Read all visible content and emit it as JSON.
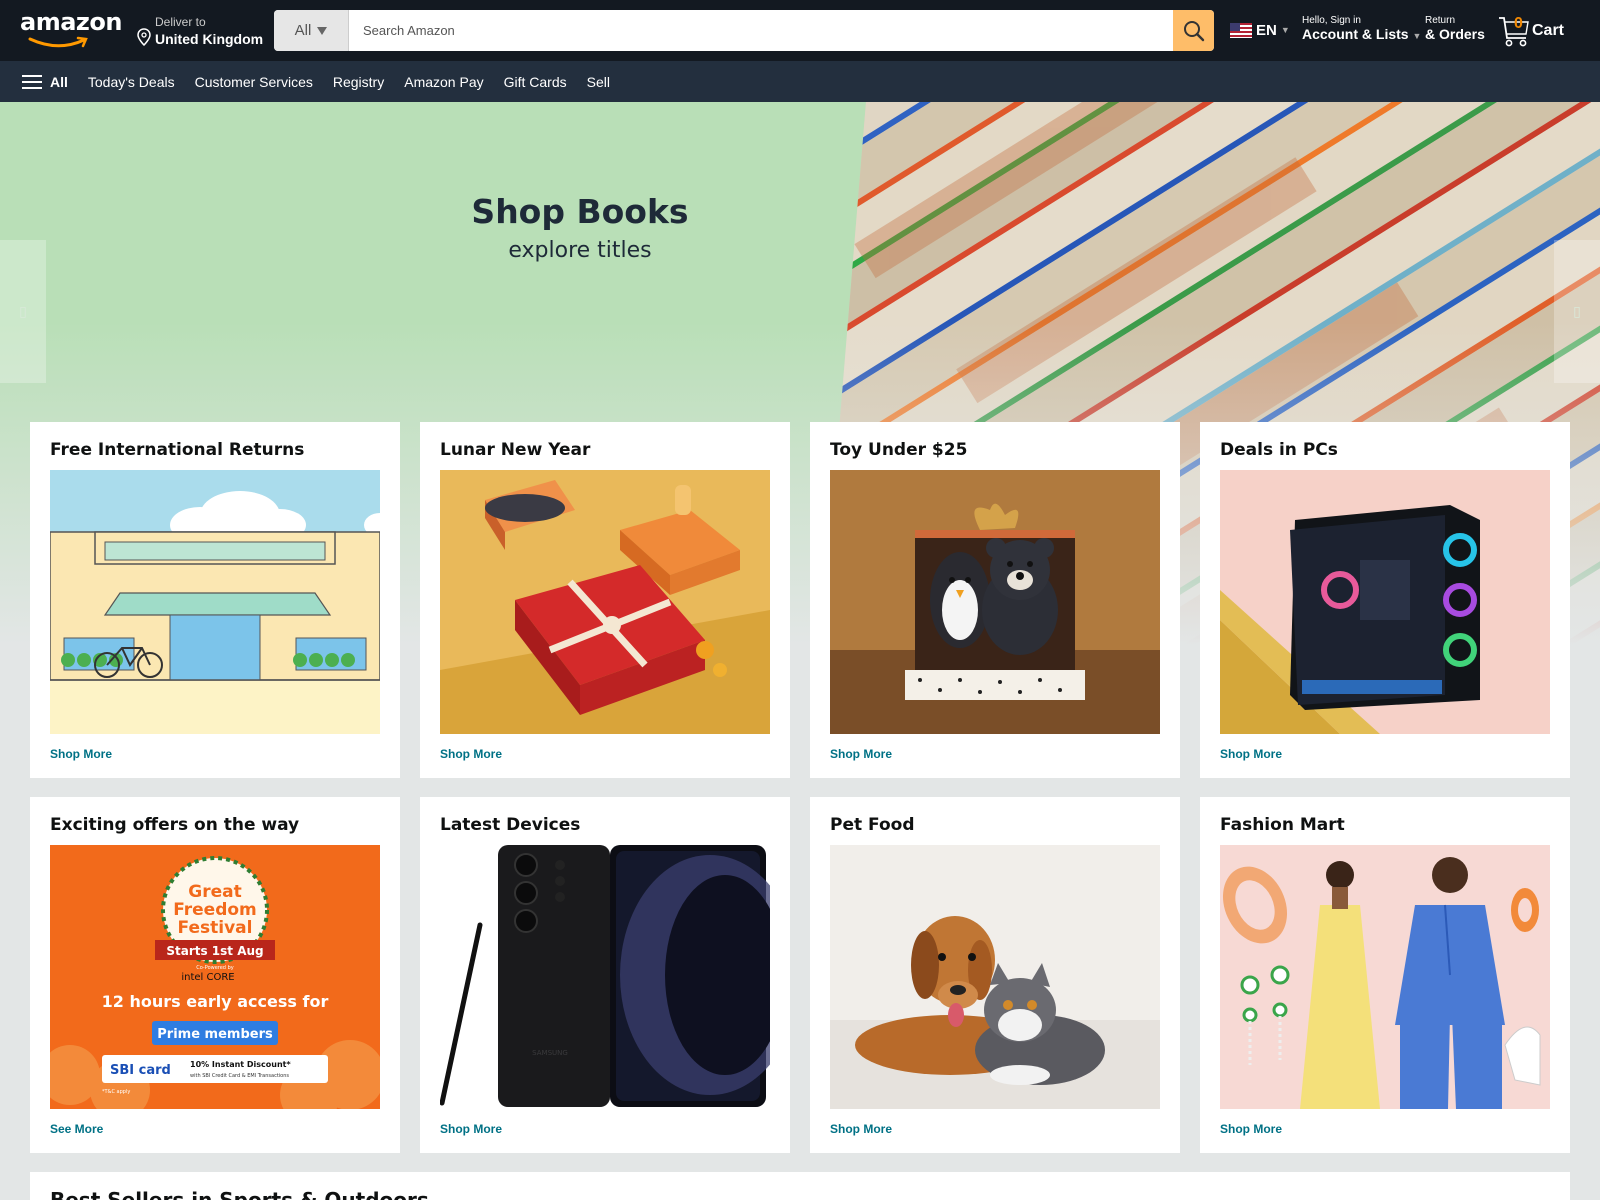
{
  "header": {
    "logo": "amazon",
    "deliver_to_label": "Deliver to",
    "deliver_to_location": "United Kingdom",
    "search_category": "All",
    "search_placeholder": "Search Amazon",
    "language": "EN",
    "account_greeting": "Hello, Sign in",
    "account_label": "Account & Lists",
    "orders_line1": "Return",
    "orders_line2": "& Orders",
    "cart_count": "0",
    "cart_label": "Cart"
  },
  "nav": {
    "all_label": "All",
    "items": [
      "Today's Deals",
      "Customer Services",
      "Registry",
      "Amazon Pay",
      "Gift Cards",
      "Sell"
    ]
  },
  "hero": {
    "title": "Shop Books",
    "subtitle": "explore titles"
  },
  "cards": [
    {
      "title": "Free International Returns",
      "link": "Shop More"
    },
    {
      "title": "Lunar New Year",
      "link": "Shop More"
    },
    {
      "title": "Toy Under $25",
      "link": "Shop More"
    },
    {
      "title": "Deals in PCs",
      "link": "Shop More"
    },
    {
      "title": "Exciting offers on the way",
      "link": "See More"
    },
    {
      "title": "Latest Devices",
      "link": "Shop More"
    },
    {
      "title": "Pet Food",
      "link": "Shop More"
    },
    {
      "title": "Fashion Mart",
      "link": "Shop More"
    }
  ],
  "promo": {
    "festival_line1": "Great",
    "festival_line2": "Freedom",
    "festival_line3": "Festival",
    "starts": "Starts 1st Aug",
    "copowered": "Co-Powered by",
    "sponsor": "intel CORE",
    "early_access": "12 hours early access for",
    "prime": "Prime members",
    "bank": "SBI card",
    "discount": "10% Instant Discount*",
    "discount_sub": "with SBI Credit Card & EMI Transactions",
    "tnc": "*T&C apply"
  },
  "device_brand": "SAMSUNG",
  "bottom_section_title": "Best Sellers in Sports & Outdoors",
  "colors": {
    "header_bg": "#131921",
    "nav_bg": "#232f3e",
    "search_button": "#febd69",
    "link": "#007185",
    "hero_bg": "#b9dfb7",
    "cart_count": "#f08804"
  }
}
